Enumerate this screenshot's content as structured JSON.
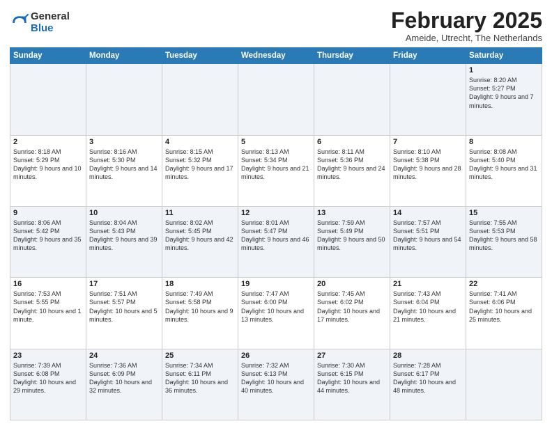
{
  "logo": {
    "general": "General",
    "blue": "Blue"
  },
  "title": "February 2025",
  "location": "Ameide, Utrecht, The Netherlands",
  "days_of_week": [
    "Sunday",
    "Monday",
    "Tuesday",
    "Wednesday",
    "Thursday",
    "Friday",
    "Saturday"
  ],
  "weeks": [
    [
      {
        "day": "",
        "info": ""
      },
      {
        "day": "",
        "info": ""
      },
      {
        "day": "",
        "info": ""
      },
      {
        "day": "",
        "info": ""
      },
      {
        "day": "",
        "info": ""
      },
      {
        "day": "",
        "info": ""
      },
      {
        "day": "1",
        "info": "Sunrise: 8:20 AM\nSunset: 5:27 PM\nDaylight: 9 hours and 7 minutes."
      }
    ],
    [
      {
        "day": "2",
        "info": "Sunrise: 8:18 AM\nSunset: 5:29 PM\nDaylight: 9 hours and 10 minutes."
      },
      {
        "day": "3",
        "info": "Sunrise: 8:16 AM\nSunset: 5:30 PM\nDaylight: 9 hours and 14 minutes."
      },
      {
        "day": "4",
        "info": "Sunrise: 8:15 AM\nSunset: 5:32 PM\nDaylight: 9 hours and 17 minutes."
      },
      {
        "day": "5",
        "info": "Sunrise: 8:13 AM\nSunset: 5:34 PM\nDaylight: 9 hours and 21 minutes."
      },
      {
        "day": "6",
        "info": "Sunrise: 8:11 AM\nSunset: 5:36 PM\nDaylight: 9 hours and 24 minutes."
      },
      {
        "day": "7",
        "info": "Sunrise: 8:10 AM\nSunset: 5:38 PM\nDaylight: 9 hours and 28 minutes."
      },
      {
        "day": "8",
        "info": "Sunrise: 8:08 AM\nSunset: 5:40 PM\nDaylight: 9 hours and 31 minutes."
      }
    ],
    [
      {
        "day": "9",
        "info": "Sunrise: 8:06 AM\nSunset: 5:42 PM\nDaylight: 9 hours and 35 minutes."
      },
      {
        "day": "10",
        "info": "Sunrise: 8:04 AM\nSunset: 5:43 PM\nDaylight: 9 hours and 39 minutes."
      },
      {
        "day": "11",
        "info": "Sunrise: 8:02 AM\nSunset: 5:45 PM\nDaylight: 9 hours and 42 minutes."
      },
      {
        "day": "12",
        "info": "Sunrise: 8:01 AM\nSunset: 5:47 PM\nDaylight: 9 hours and 46 minutes."
      },
      {
        "day": "13",
        "info": "Sunrise: 7:59 AM\nSunset: 5:49 PM\nDaylight: 9 hours and 50 minutes."
      },
      {
        "day": "14",
        "info": "Sunrise: 7:57 AM\nSunset: 5:51 PM\nDaylight: 9 hours and 54 minutes."
      },
      {
        "day": "15",
        "info": "Sunrise: 7:55 AM\nSunset: 5:53 PM\nDaylight: 9 hours and 58 minutes."
      }
    ],
    [
      {
        "day": "16",
        "info": "Sunrise: 7:53 AM\nSunset: 5:55 PM\nDaylight: 10 hours and 1 minute."
      },
      {
        "day": "17",
        "info": "Sunrise: 7:51 AM\nSunset: 5:57 PM\nDaylight: 10 hours and 5 minutes."
      },
      {
        "day": "18",
        "info": "Sunrise: 7:49 AM\nSunset: 5:58 PM\nDaylight: 10 hours and 9 minutes."
      },
      {
        "day": "19",
        "info": "Sunrise: 7:47 AM\nSunset: 6:00 PM\nDaylight: 10 hours and 13 minutes."
      },
      {
        "day": "20",
        "info": "Sunrise: 7:45 AM\nSunset: 6:02 PM\nDaylight: 10 hours and 17 minutes."
      },
      {
        "day": "21",
        "info": "Sunrise: 7:43 AM\nSunset: 6:04 PM\nDaylight: 10 hours and 21 minutes."
      },
      {
        "day": "22",
        "info": "Sunrise: 7:41 AM\nSunset: 6:06 PM\nDaylight: 10 hours and 25 minutes."
      }
    ],
    [
      {
        "day": "23",
        "info": "Sunrise: 7:39 AM\nSunset: 6:08 PM\nDaylight: 10 hours and 29 minutes."
      },
      {
        "day": "24",
        "info": "Sunrise: 7:36 AM\nSunset: 6:09 PM\nDaylight: 10 hours and 32 minutes."
      },
      {
        "day": "25",
        "info": "Sunrise: 7:34 AM\nSunset: 6:11 PM\nDaylight: 10 hours and 36 minutes."
      },
      {
        "day": "26",
        "info": "Sunrise: 7:32 AM\nSunset: 6:13 PM\nDaylight: 10 hours and 40 minutes."
      },
      {
        "day": "27",
        "info": "Sunrise: 7:30 AM\nSunset: 6:15 PM\nDaylight: 10 hours and 44 minutes."
      },
      {
        "day": "28",
        "info": "Sunrise: 7:28 AM\nSunset: 6:17 PM\nDaylight: 10 hours and 48 minutes."
      },
      {
        "day": "",
        "info": ""
      }
    ]
  ]
}
